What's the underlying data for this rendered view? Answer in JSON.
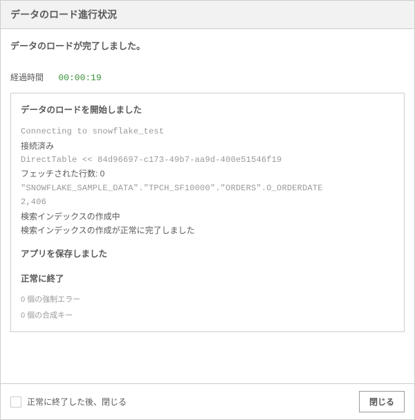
{
  "header": {
    "title": "データのロード進行状況"
  },
  "body": {
    "status_message": "データのロードが完了しました。",
    "elapsed_label": "経過時間",
    "elapsed_time": "00:00:19"
  },
  "log": {
    "heading_start": "データのロードを開始しました",
    "lines": [
      {
        "text": "Connecting to snowflake_test",
        "mono": true
      },
      {
        "text": "接続済み",
        "mono": false
      },
      {
        "text": "DirectTable << 84d96697-c173-49b7-aa9d-400e51546f19",
        "mono": true
      },
      {
        "text": "フェッチされた行数: 0",
        "mono": false
      },
      {
        "text": "\"SNOWFLAKE_SAMPLE_DATA\".\"TPCH_SF10000\".\"ORDERS\".O_ORDERDATE",
        "mono": true
      },
      {
        "text": "2,406",
        "mono": true
      },
      {
        "text": "検索インデックスの作成中",
        "mono": false
      },
      {
        "text": "検索インデックスの作成が正常に完了しました",
        "mono": false
      }
    ],
    "heading_saved": "アプリを保存しました",
    "heading_done": "正常に終了",
    "summary_forced_errors": "0 個の強制エラー",
    "summary_synth_keys": "0 個の合成キー"
  },
  "footer": {
    "close_after_done_label": "正常に終了した後、閉じる",
    "close_button": "閉じる"
  }
}
